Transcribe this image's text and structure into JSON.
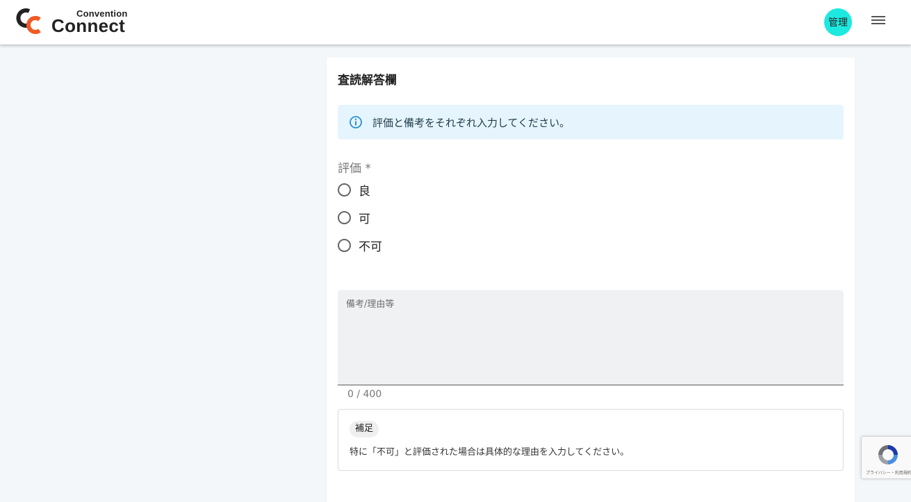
{
  "header": {
    "logo_small": "Convention",
    "logo_big": "Connect",
    "avatar_label": "管理",
    "logo_colors": {
      "dark": "#222222",
      "accent": "#f15a24"
    },
    "avatar_color": "#1de9e0",
    "menu_icon": "hamburger-menu-icon"
  },
  "card": {
    "title": "査読解答欄",
    "info": {
      "icon": "info-icon",
      "text": "評価と備考をそれぞれ入力してください。",
      "background": "#e6f5fd"
    },
    "rating": {
      "label": "評価 *",
      "options": [
        "良",
        "可",
        "不可"
      ]
    },
    "remarks": {
      "label": "備考/理由等",
      "value": "",
      "counter": "0 / 400"
    },
    "note": {
      "chip": "補足",
      "text": "特に「不可」と評価された場合は具体的な理由を入力してください。"
    }
  },
  "recaptcha": {
    "text": "プライバシー・利用規約"
  }
}
